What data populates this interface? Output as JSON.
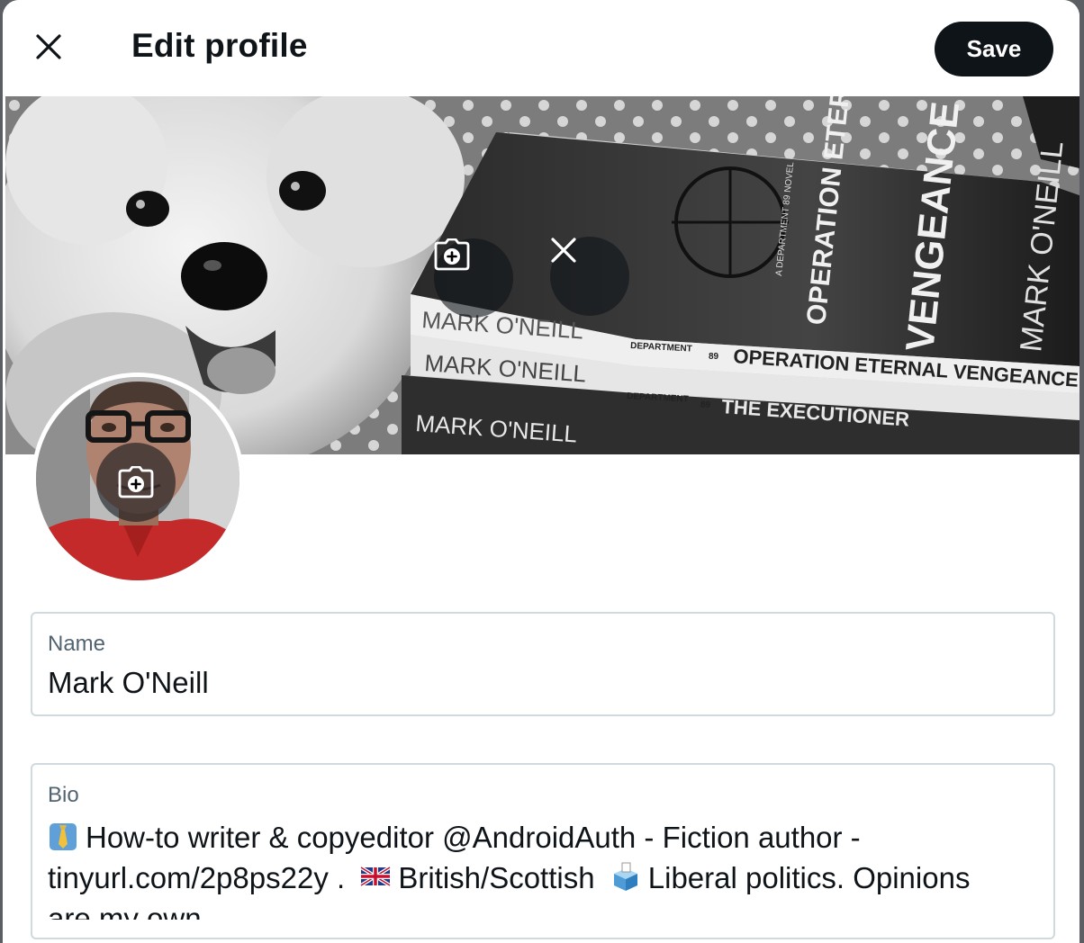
{
  "header": {
    "title": "Edit profile",
    "save_label": "Save",
    "close_icon": "close-icon"
  },
  "banner": {
    "book_texts": [
      "MARK O'NEILL",
      "MARK O'NEILL",
      "MARK O'NEILL",
      "DEPARTMENT",
      "OPERATION ETERNAL VENGEANCE",
      "DEPARTMENT",
      "THE EXECUTIONER",
      "OPERATION ETERNAL",
      "VENGEANCE",
      "MARK O'NEILL",
      "A DEPARTMENT 89 NOVEL",
      "89",
      "89"
    ],
    "add_photo_icon": "camera-plus-icon",
    "remove_icon": "close-icon"
  },
  "avatar": {
    "add_photo_icon": "camera-plus-icon"
  },
  "name_field": {
    "label": "Name",
    "value": "Mark O'Neill"
  },
  "bio_field": {
    "label": "Bio",
    "line1": "How-to writer & copyeditor @AndroidAuth - Fiction author -",
    "line2a": "tinyurl.com/2p8ps22y .",
    "line2b": "British/Scottish",
    "line2c": "Liberal politics. Opinions",
    "line3": "are my own.",
    "emoji_icons": [
      "necktie-icon",
      "uk-flag-icon",
      "ballot-box-icon"
    ]
  },
  "colors": {
    "primary_button": "#0f1419",
    "border": "#cfd9de",
    "label": "#536471",
    "overlay_button": "rgba(15,20,25,0.6)"
  }
}
